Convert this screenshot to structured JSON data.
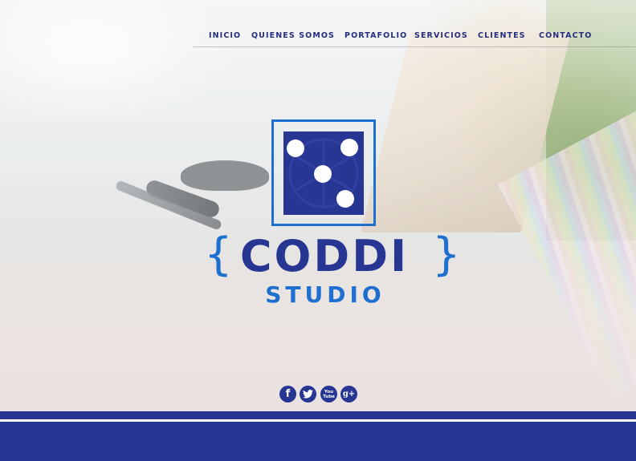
{
  "nav": {
    "items": [
      {
        "label": "INICIO"
      },
      {
        "label": "QUIENES SOMOS"
      },
      {
        "label": "PORTAFOLIO"
      },
      {
        "label": "SERVICIOS"
      },
      {
        "label": "CLIENTES"
      },
      {
        "label": "CONTACTO"
      }
    ]
  },
  "brand": {
    "name": "CODDI",
    "subtitle": "STUDIO",
    "brace_open": "{",
    "brace_close": "}",
    "colors": {
      "primary": "#263692",
      "accent": "#1d6fd0"
    }
  },
  "social": [
    {
      "icon": "facebook-icon",
      "glyph": "f"
    },
    {
      "icon": "twitter-icon",
      "glyph": "t"
    },
    {
      "icon": "youtube-icon",
      "glyph": "You\nTube"
    },
    {
      "icon": "google-plus-icon",
      "glyph": "g+"
    }
  ],
  "footer": {
    "color": "#263692"
  }
}
